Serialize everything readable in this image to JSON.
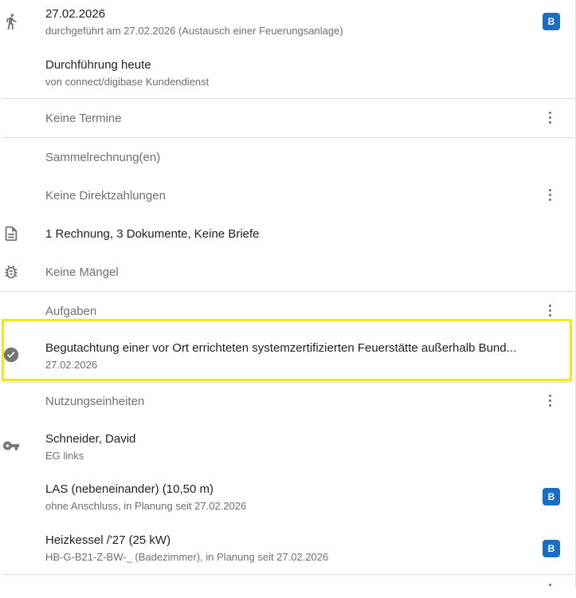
{
  "entries": {
    "inspection": {
      "date": "27.02.2026",
      "detail": "durchgeführt am 27.02.2026 (Austausch einer Feuerungsanlage)",
      "badge": "B"
    },
    "execution": {
      "title": "Durchführung heute",
      "detail": "von connect/digibase Kundendienst"
    }
  },
  "sections": {
    "appointments": "Keine Termine",
    "collective_invoices": "Sammelrechnung(en)",
    "direct_payments": "Keine Direktzahlungen",
    "documents": "1 Rechnung, 3 Dokumente, Keine Briefe",
    "defects": "Keine Mängel",
    "tasks": "Aufgaben",
    "usage_units": "Nutzungseinheiten"
  },
  "task_item": {
    "title": "Begutachtung einer vor Ort errichteten systemzertifizierten Feuerstätte außerhalb Bund...",
    "date": "27.02.2026"
  },
  "usage_unit": {
    "name": "Schneider, David",
    "location": "EG links"
  },
  "devices": [
    {
      "title": "LAS (nebeneinander) (10,50 m)",
      "detail": "ohne Anschluss, in Planung seit 27.02.2026",
      "badge": "B"
    },
    {
      "title": "Heizkessel /'27 (25 kW)",
      "detail": "HB-G-B21-Z-BW-_ (Badezimmer), in Planung seit 27.02.2026",
      "badge": "B"
    }
  ],
  "icons": {
    "walk": "walking-person-icon",
    "document": "document-icon",
    "bug": "bug-icon",
    "check": "check-circle-icon",
    "key": "key-icon",
    "more": "more-vert-icon"
  },
  "colors": {
    "badge": "#1a6fc4",
    "highlight": "#f7e21f",
    "muted_text": "#6e6e6e"
  }
}
